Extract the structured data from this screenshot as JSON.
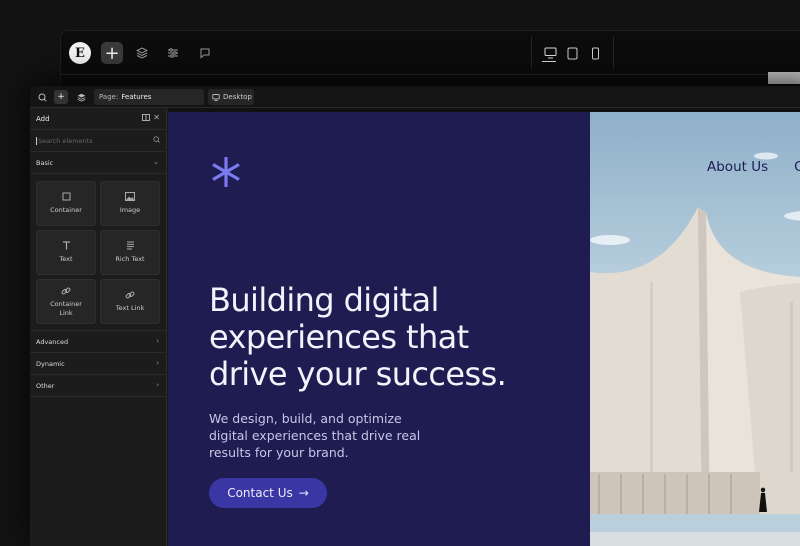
{
  "editor": {
    "page_label": "Page:",
    "page_name": "Features",
    "device": "Desktop"
  },
  "panel": {
    "title": "Add",
    "search_placeholder": "Search elements",
    "basic_label": "Basic",
    "tiles": [
      {
        "label": "Container",
        "icon": "square-icon"
      },
      {
        "label": "Image",
        "icon": "image-icon"
      },
      {
        "label": "Text",
        "icon": "text-icon"
      },
      {
        "label": "Rich Text",
        "icon": "rich-text-icon"
      },
      {
        "label": "Container\nLink",
        "icon": "link-icon"
      },
      {
        "label": "Text Link",
        "icon": "link-icon"
      }
    ],
    "sections": [
      "Advanced",
      "Dynamic",
      "Other"
    ]
  },
  "hero": {
    "headline_line1": "Building digital",
    "headline_line2": "experiences that",
    "headline_line3": "drive your success.",
    "sub_line1": "We design, build, and optimize",
    "sub_line2": "digital experiences that drive real",
    "sub_line3": "results for your brand.",
    "cta_label": "Contact Us",
    "cta_arrow": "→",
    "nav_items": [
      "About Us",
      "Ou"
    ]
  },
  "colors": {
    "hero_bg": "#1f1c52",
    "accent": "#7b7bf0",
    "cta_bg": "#3a36a3"
  }
}
